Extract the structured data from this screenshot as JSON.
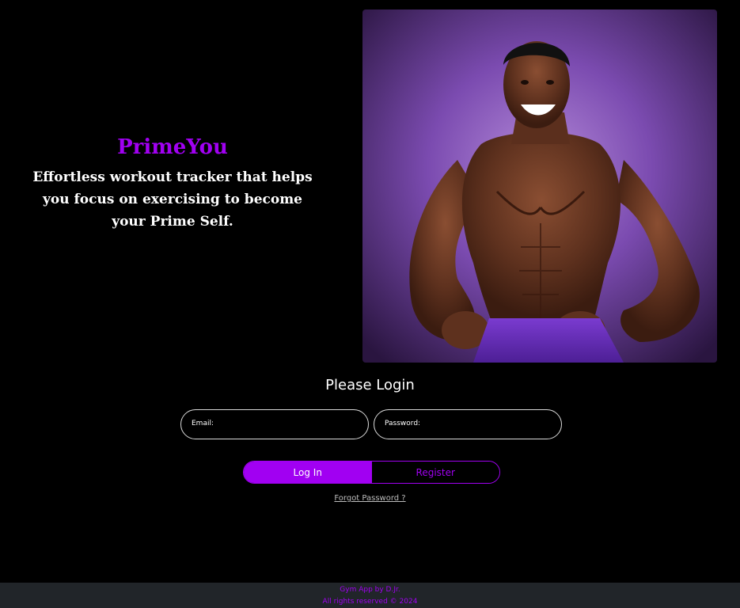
{
  "hero": {
    "brand": "PrimeYou",
    "tagline": "Effortless workout tracker that helps you focus on exercising to become your Prime Self.",
    "image": {
      "subject": "muscular-man-illustration",
      "background_color": "#7b4bb0"
    }
  },
  "login": {
    "title": "Please Login",
    "email_label": "Email:",
    "email_value": "",
    "password_label": "Password:",
    "password_value": "",
    "login_button": "Log In",
    "register_button": "Register",
    "forgot_link": "Forgot Password ?"
  },
  "footer": {
    "line1": "Gym App by D.Jr.",
    "line2": "All rights reserved © 2024"
  },
  "colors": {
    "accent": "#a100f2",
    "background": "#000000",
    "footer_bg": "#212529"
  }
}
